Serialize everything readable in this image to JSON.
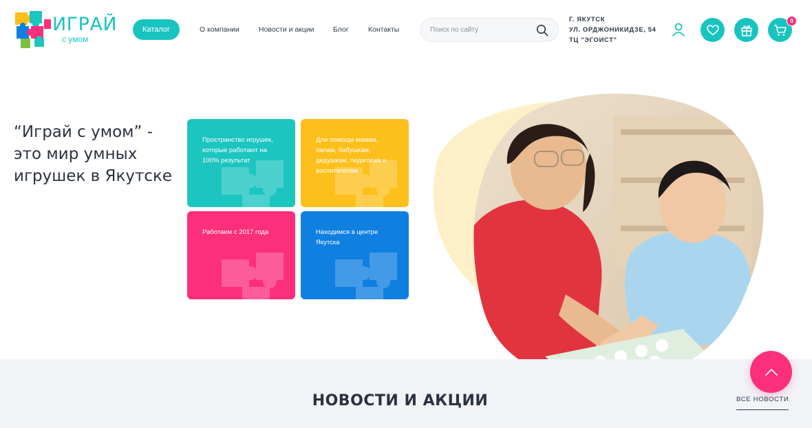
{
  "brand": {
    "name": "ИГРАЙ",
    "tagline": "с умом"
  },
  "header": {
    "catalog_label": "Каталог",
    "nav": [
      "О компании",
      "Новости и акции",
      "Блог",
      "Контакты"
    ],
    "search_placeholder": "Поиск по сайту",
    "address": [
      "Г. ЯКУТСК",
      "УЛ. ОРДЖОНИКИДЗЕ, 54",
      "ТЦ \"ЭГОИСТ\""
    ],
    "cart_count": "0",
    "icons": [
      "user-icon",
      "heart-icon",
      "gift-icon",
      "cart-icon",
      "search-icon"
    ]
  },
  "hero": {
    "title": "“Играй с умом” - это мир умных игрушек в Якутске",
    "tiles": [
      {
        "text": "Пространство игрушек, которые работают на 100% результат",
        "color": "#1cc5c0"
      },
      {
        "text": "Для помощи мамам, папам, бабушкам, дедушкам, педагогам и воспитателям",
        "color": "#fdbf1b"
      },
      {
        "text": "Работаем с 2017 года",
        "color": "#fb2f7a"
      },
      {
        "text": "Находимся в центре Якутска",
        "color": "#0f7fe0"
      }
    ]
  },
  "news": {
    "title": "НОВОСТИ И АКЦИИ",
    "all_label": "ВСЕ НОВОСТИ"
  },
  "colors": {
    "teal": "#18c4c0",
    "pink": "#fb2f7a",
    "yellow": "#fdbf1b",
    "blue": "#0f7fe0",
    "text": "#2b3340"
  }
}
